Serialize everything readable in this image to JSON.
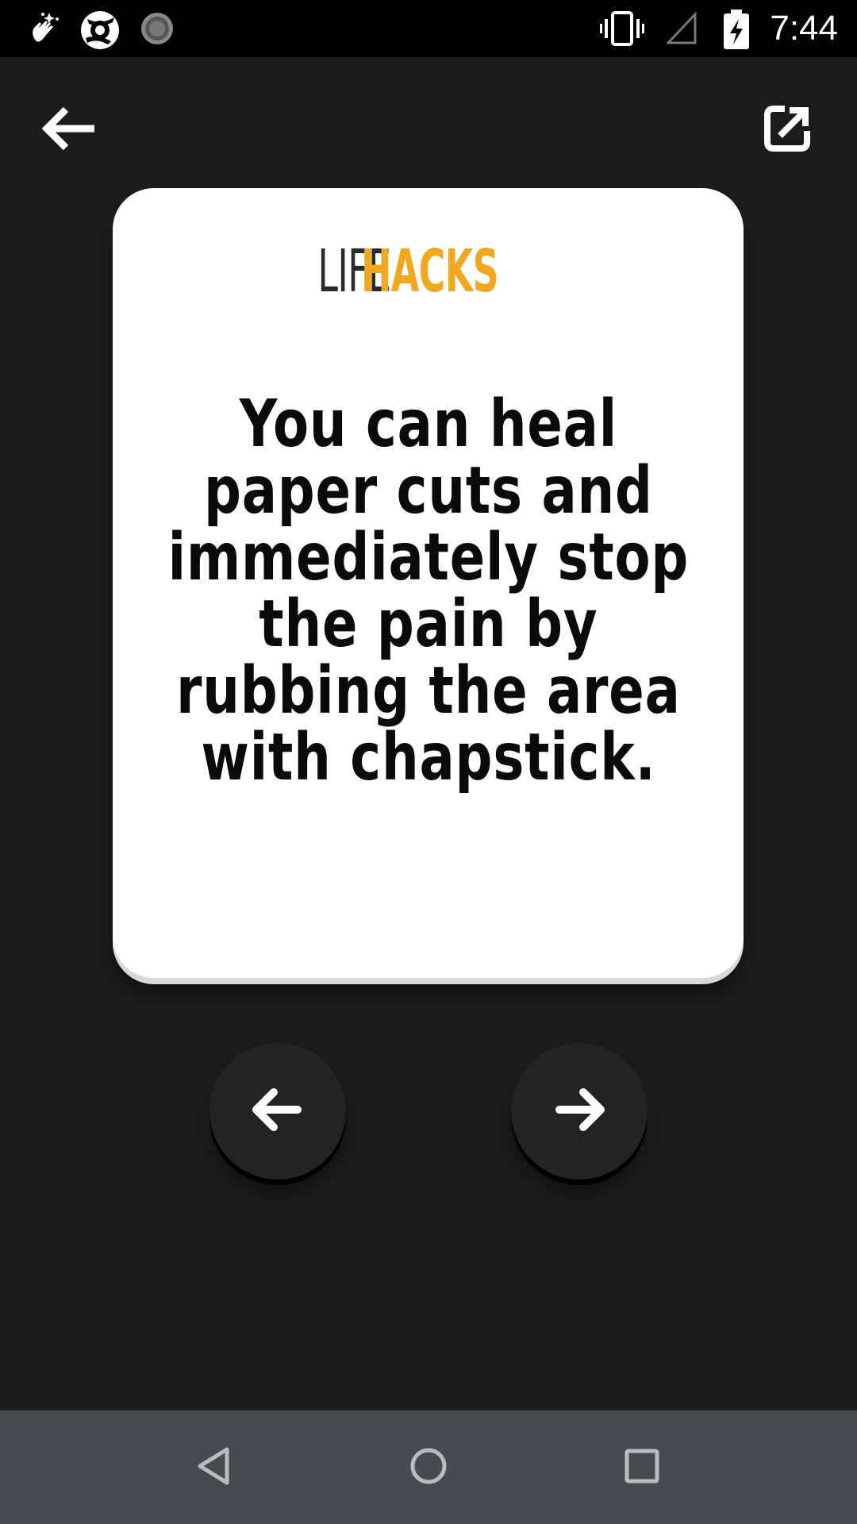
{
  "status_bar": {
    "time": "7:44",
    "icons": [
      "cleaner-hand-icon",
      "aperture-app-icon",
      "loading-spinner-icon",
      "vibrate-icon",
      "no-signal-icon",
      "battery-charging-icon"
    ]
  },
  "top_bar": {
    "back_icon": "arrow-left-icon",
    "share_icon": "share-external-icon"
  },
  "card": {
    "logo": {
      "word1": "LIFE",
      "word2": "HACKS",
      "accent_color": "#f0a81e"
    },
    "fact": "You can heal paper cuts and immediately stop the pain by rubbing the area with chapstick."
  },
  "navigation": {
    "prev_icon": "arrow-left-icon",
    "next_icon": "arrow-right-icon"
  },
  "android_nav": {
    "keys": [
      "back-triangle-icon",
      "home-circle-icon",
      "recents-square-icon"
    ]
  },
  "colors": {
    "background": "#1c1c1e",
    "card": "#ffffff",
    "accent": "#f0a81e",
    "nav_bar": "#454b50"
  }
}
